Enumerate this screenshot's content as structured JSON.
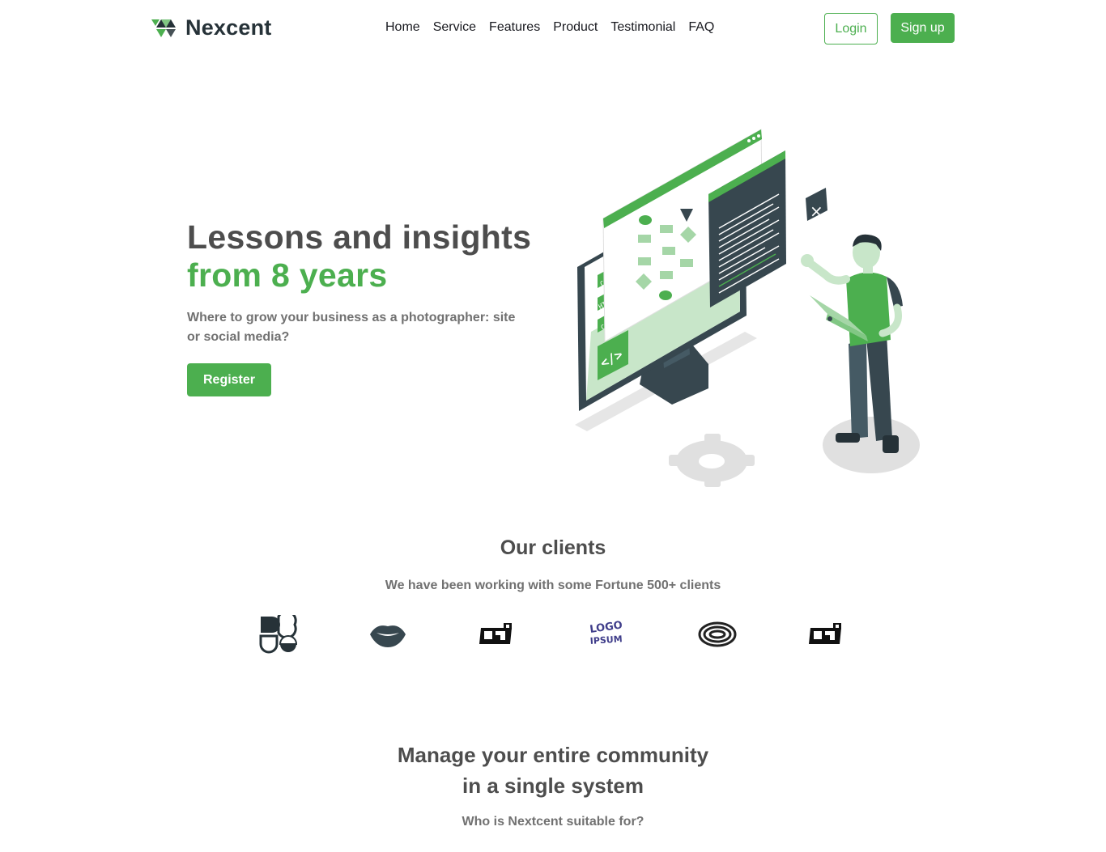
{
  "brand": {
    "name": "Nexcent",
    "accent": "#4caf4f",
    "dark": "#263238"
  },
  "nav": {
    "items": [
      "Home",
      "Service",
      "Features",
      "Product",
      "Testimonial",
      "FAQ"
    ]
  },
  "auth": {
    "login": "Login",
    "signup": "Sign up"
  },
  "hero": {
    "title_line1": "Lessons and insights",
    "title_line2": "from 8 years",
    "subtitle": "Where to grow your business as a photographer: site or social media?",
    "cta": "Register",
    "illustration": {
      "code_labels": [
        "CSS",
        "HTML",
        "C++"
      ]
    }
  },
  "clients": {
    "title": "Our clients",
    "subtitle": "We have been working with some Fortune 500+ clients",
    "logos": [
      "client-logo-shapes-icon",
      "client-logo-lips-icon",
      "client-logo-block-icon",
      "client-logo-logoipsum-icon",
      "client-logo-rings-icon",
      "client-logo-block-icon"
    ],
    "logoipsum_text": [
      "LOGO",
      "IPSUM"
    ]
  },
  "community": {
    "title_line1": "Manage your entire community",
    "title_line2": "in a single system",
    "subtitle": "Who is Nextcent suitable for?"
  }
}
